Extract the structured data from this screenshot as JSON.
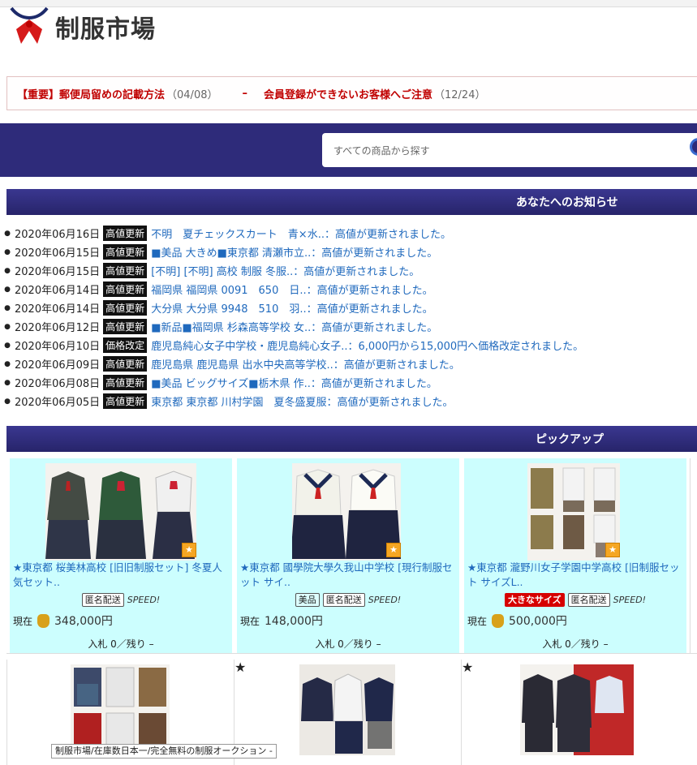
{
  "site": {
    "name": "制服市場"
  },
  "notices": [
    {
      "title": "【重要】郵便局留めの記載方法",
      "date": "（04/08）"
    },
    {
      "title": "会員登録ができないお客様へご注意",
      "date": "（12/24）"
    }
  ],
  "notice_sep": "–",
  "search": {
    "placeholder": "すべての商品から探す"
  },
  "news_section": {
    "title": "あなたへのお知らせ"
  },
  "news": [
    {
      "date": "2020年06月16日",
      "tag": "高値更新",
      "text": "不明　夏チェックスカート　青×水..：高値が更新されました。"
    },
    {
      "date": "2020年06月15日",
      "tag": "高値更新",
      "text": "■美品 大きめ■東京都 清瀬市立..：高値が更新されました。"
    },
    {
      "date": "2020年06月15日",
      "tag": "高値更新",
      "text": "[不明] [不明] 高校 制服 冬服..：高値が更新されました。"
    },
    {
      "date": "2020年06月14日",
      "tag": "高値更新",
      "text": "福岡県 福岡県 0091　650　日..：高値が更新されました。"
    },
    {
      "date": "2020年06月14日",
      "tag": "高値更新",
      "text": "大分県 大分県 9948　510　羽..：高値が更新されました。"
    },
    {
      "date": "2020年06月12日",
      "tag": "高値更新",
      "text": "■新品■福岡県 杉森高等学校 女..：高値が更新されました。"
    },
    {
      "date": "2020年06月10日",
      "tag": "価格改定",
      "text": "鹿児島純心女子中学校・鹿児島純心女子..：6,000円から15,000円へ価格改定されました。"
    },
    {
      "date": "2020年06月09日",
      "tag": "高値更新",
      "text": "鹿児島県 鹿児島県 出水中央高等学校..：高値が更新されました。"
    },
    {
      "date": "2020年06月08日",
      "tag": "高値更新",
      "text": "■美品 ビッグサイズ■栃木県 作..：高値が更新されました。"
    },
    {
      "date": "2020年06月05日",
      "tag": "高値更新",
      "text": "東京都 東京都 川村学園　夏冬盛夏服：高値が更新されました。"
    }
  ],
  "pickup_section": {
    "title": "ピックアップ"
  },
  "pickup": [
    {
      "title": "★東京都 桜美林高校 [旧旧制服セット] 冬夏人気セット..",
      "badges": [
        "匿名配送"
      ],
      "speed": "SPEED!",
      "price_label": "現在",
      "price": "348,000円",
      "bids": "入札 0／残り –"
    },
    {
      "title": "★東京都 國學院大學久我山中学校 [現行制服セット サイ..",
      "badges": [
        "美品",
        "匿名配送"
      ],
      "speed": "SPEED!",
      "price_label": "現在",
      "price": "148,000円",
      "bids": "入札 0／残り –"
    },
    {
      "title": "★東京都 瀧野川女子学園中学高校 [旧制服セット サイズL..",
      "badges": [
        "大きなサイズ",
        "匿名配送"
      ],
      "speed": "SPEED!",
      "price_label": "現在",
      "price": "500,000円",
      "bids": "入札 0／残り –"
    }
  ],
  "tooltip": "制服市場/在庫数日本一/完全無料の制服オークション -"
}
